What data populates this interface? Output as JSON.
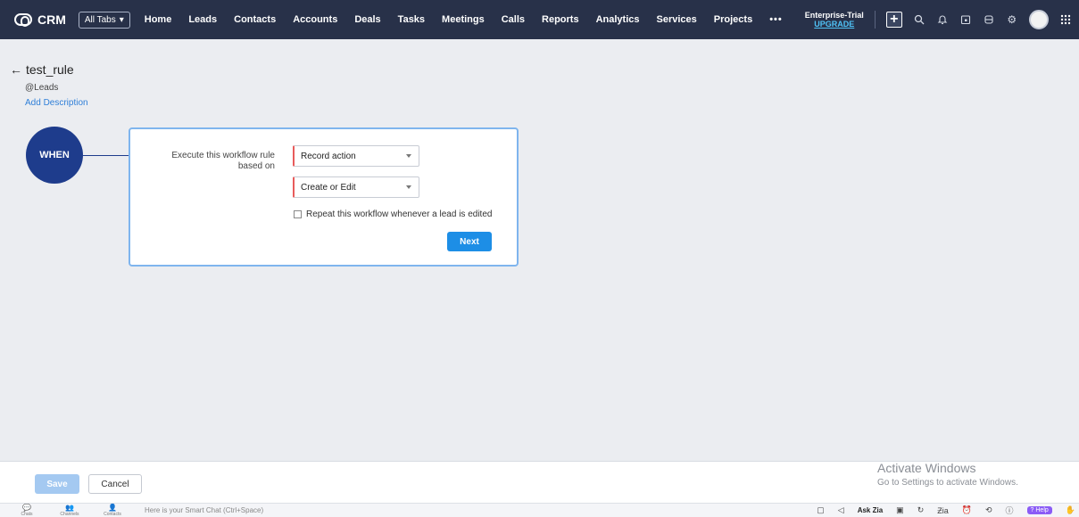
{
  "topbar": {
    "brand": "CRM",
    "all_tabs": "All Tabs",
    "nav": [
      "Home",
      "Leads",
      "Contacts",
      "Accounts",
      "Deals",
      "Tasks",
      "Meetings",
      "Calls",
      "Reports",
      "Analytics",
      "Services",
      "Projects"
    ],
    "more": "•••",
    "trial_line1": "Enterprise-Trial",
    "trial_line2": "UPGRADE",
    "icons": [
      "plus-icon",
      "search-icon",
      "bell-icon",
      "calendar-icon",
      "marketplace-icon",
      "settings-icon",
      "avatar",
      "apps-grid-icon"
    ]
  },
  "rule": {
    "back_arrow": "←",
    "name": "test_rule",
    "module": "@Leads",
    "add_description": "Add Description"
  },
  "when": {
    "label": "WHEN",
    "execute_label": "Execute this workflow rule based on",
    "select_trigger": "Record action",
    "select_action": "Create or Edit",
    "repeat_label": "Repeat this workflow whenever a lead is edited",
    "next": "Next"
  },
  "footer": {
    "save": "Save",
    "cancel": "Cancel",
    "watermark_1": "Activate Windows",
    "watermark_2": "Go to Settings to activate Windows."
  },
  "chatbar": {
    "items": [
      "Chats",
      "Channels",
      "Contacts"
    ],
    "placeholder": "Here is your Smart Chat (Ctrl+Space)",
    "ask_zia": "Ask Zia",
    "zia_glyph": "Ƶia",
    "help": "Help"
  }
}
